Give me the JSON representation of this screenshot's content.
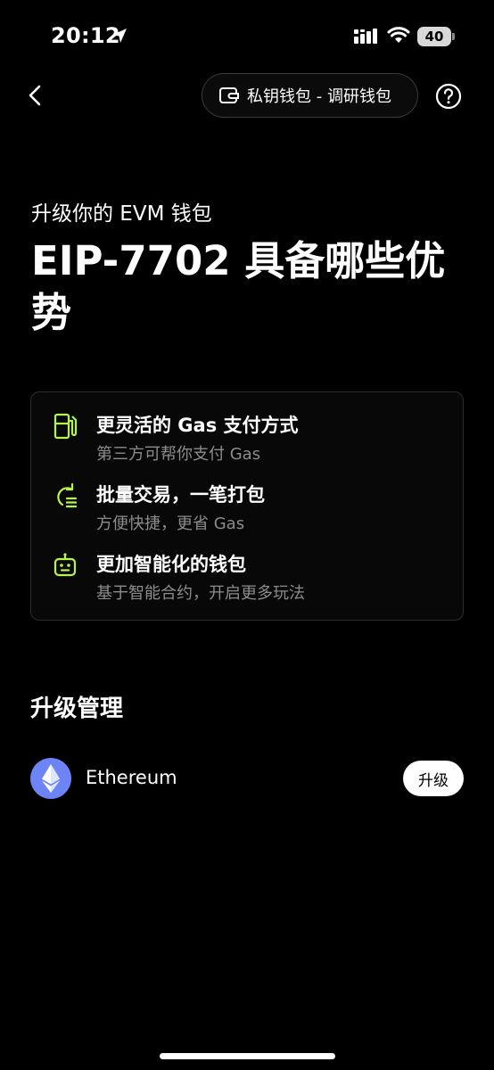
{
  "status_bar": {
    "time": "20:12",
    "battery": "40"
  },
  "nav": {
    "wallet_label": "私钥钱包 - 调研钱包"
  },
  "header": {
    "subtitle": "升级你的 EVM 钱包",
    "title": "EIP-7702 具备哪些优势"
  },
  "features": [
    {
      "title": "更灵活的 Gas 支付方式",
      "desc": "第三方可帮你支付 Gas",
      "icon": "gas-pump-icon"
    },
    {
      "title": "批量交易，一笔打包",
      "desc": "方便快捷，更省 Gas",
      "icon": "batch-refresh-icon"
    },
    {
      "title": "更加智能化的钱包",
      "desc": "基于智能合约，开启更多玩法",
      "icon": "robot-icon"
    }
  ],
  "upgrade_section": {
    "title": "升级管理",
    "chains": [
      {
        "name": "Ethereum",
        "button_label": "升级",
        "icon": "ethereum-icon"
      }
    ]
  },
  "colors": {
    "accent_green": "#b7f34a",
    "eth_blue": "#6c84f5",
    "muted_text": "#8c8c8c"
  }
}
